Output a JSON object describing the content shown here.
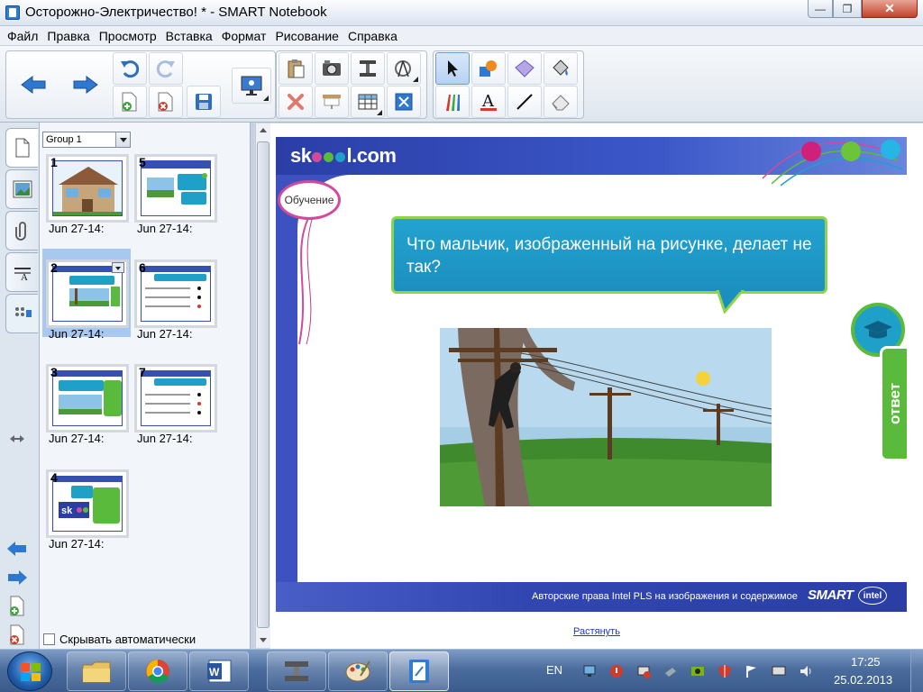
{
  "window": {
    "title": "Осторожно-Электричество! * - SMART Notebook",
    "min_glyph": "—",
    "max_glyph": "❐",
    "close_glyph": "✕"
  },
  "menu": [
    "Файл",
    "Правка",
    "Просмотр",
    "Вставка",
    "Формат",
    "Рисование",
    "Справка"
  ],
  "toolbar": {
    "buttons": [
      "back-arrow-icon",
      "forward-arrow-icon",
      "undo-icon",
      "redo-icon",
      "new-page-icon",
      "delete-page-icon",
      "save-icon",
      "display-mode-icon",
      "paste-icon",
      "screen-capture-icon",
      "document-camera-icon",
      "measurement-tools-icon",
      "delete-icon",
      "screen-shade-icon",
      "table-icon",
      "full-screen-icon",
      "select-icon",
      "shapes-icon",
      "eraser-shape-icon",
      "fill-icon",
      "pens-icon",
      "text-icon",
      "line-icon",
      "eraser-icon"
    ]
  },
  "sorter": {
    "group": "Group 1",
    "pages": [
      {
        "num": "1",
        "date": "Jun 27-14:"
      },
      {
        "num": "5",
        "date": "Jun 27-14:"
      },
      {
        "num": "2",
        "date": "Jun 27-14:"
      },
      {
        "num": "6",
        "date": "Jun 27-14:"
      },
      {
        "num": "3",
        "date": "Jun 27-14:"
      },
      {
        "num": "7",
        "date": "Jun 27-14:"
      },
      {
        "num": "4",
        "date": "Jun 27-14:"
      }
    ],
    "autohide_label": "Скрывать автоматически"
  },
  "slide": {
    "logo_left": "sk",
    "logo_right": "l.com",
    "learning_label": "Обучение",
    "question": "Что мальчик, изображенный на рисунке, делает не так?",
    "answer_label": "ответ",
    "copyright": "Авторские права Intel PLS на изображения и содержимое",
    "smart_logo": "SMART",
    "intel_logo": "intel"
  },
  "canvas": {
    "stretch_link": "Растянуть"
  },
  "taskbar": {
    "lang": "EN",
    "time": "17:25",
    "date": "25.02.2013"
  }
}
